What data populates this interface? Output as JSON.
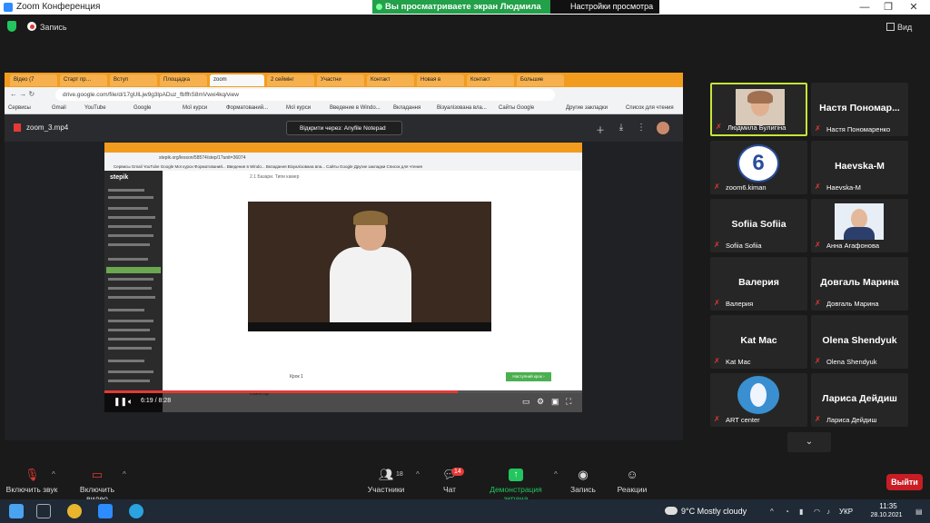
{
  "window": {
    "title": "Zoom Конференция",
    "share_banner": "Вы просматриваете экран Людмила Булигіна",
    "view_settings": "Настройки просмотра ▾",
    "min": "—",
    "max": "❐",
    "close": "✕"
  },
  "toolbar": {
    "record_label": "Запись",
    "view_label": "Вид"
  },
  "shared_screen": {
    "browser_tabs": [
      "Відео (7",
      "Старт пр…",
      "Вступ",
      "Площадка",
      "zoom",
      "2 сеймінг",
      "Участни",
      "Контакт",
      "Новая в",
      "Контакт",
      "Большие"
    ],
    "url": "drive.google.com/file/d/17gUlLjw9g3lpADuz_fbffhS8mVwxi4kq/view",
    "bookmarks": [
      "Сервисы",
      "Gmail",
      "YouTube",
      "Google",
      "Мої курси",
      "Форматований...",
      "Мої курси",
      "Введение в Windo...",
      "Вкладання",
      "Візуалізована вла...",
      "Сайты Google",
      "Другие закладки",
      "Список для чтения"
    ],
    "file_name": "zoom_3.mp4",
    "open_with": "Відкрити через: Anyfile Notepad",
    "inner": {
      "url": "stepik.org/lesson/58574/step/1?unit=36074",
      "bookmarks": "Сервисы   Gmail   YouTube   Google   Мої курси   Форматований...   Введение в Windo...   Вкладання   Візуалізована вла...   Сайты Google   Другие закладки   Список для чтения",
      "logo": "stepik",
      "lesson_title": "2.1 Базари. Типи камер",
      "lesson_step": "Крок 1",
      "next_button": "Наступний крок ›",
      "comments": "Коментарі"
    },
    "player_time": "6:19 / 8:28",
    "progress_fraction": 0.74
  },
  "participants": [
    {
      "name": "Людмила Булигіна",
      "display": "photo",
      "active": true
    },
    {
      "name": "Настя Пономаренко",
      "display": "Настя Пономар...",
      "active": false
    },
    {
      "name": "zoom6.kiman",
      "display": "logo",
      "active": false
    },
    {
      "name": "Haevska-M",
      "display": "Haevska-M",
      "active": false
    },
    {
      "name": "Sofiia Sofiia",
      "display": "Sofiia Sofiia",
      "active": false
    },
    {
      "name": "Анна Агафонова",
      "display": "photo",
      "active": false
    },
    {
      "name": "Валерия",
      "display": "Валерия",
      "active": false
    },
    {
      "name": "Довгаль Марина",
      "display": "Довгаль Марина",
      "active": false
    },
    {
      "name": "Kat Mac",
      "display": "Kat Mac",
      "active": false
    },
    {
      "name": "Olena Shendyuk",
      "display": "Olena Shendyuk",
      "active": false
    },
    {
      "name": "ART center",
      "display": "logo",
      "active": false
    },
    {
      "name": "Лариса Дейдиш",
      "display": "Лариса Дейдиш",
      "active": false
    }
  ],
  "bottom_bar": {
    "unmute": "Включить звук",
    "start_video": "Включить видео",
    "participants": "Участники",
    "participants_count": "18",
    "chat": "Чат",
    "chat_badge": "14",
    "share_screen": "Демонстрация экрана",
    "record": "Запись",
    "reactions": "Реакции",
    "leave": "Выйти"
  },
  "taskbar": {
    "weather": "9°C  Mostly cloudy",
    "lang": "УКР",
    "time": "11:35",
    "date": "28.10.2021"
  },
  "colors": {
    "share_banner": "#22a04a",
    "active_speaker": "#c6e53a",
    "leave": "#c81d25",
    "share_screen_icon": "#22c55e",
    "muted": "#e53935"
  }
}
